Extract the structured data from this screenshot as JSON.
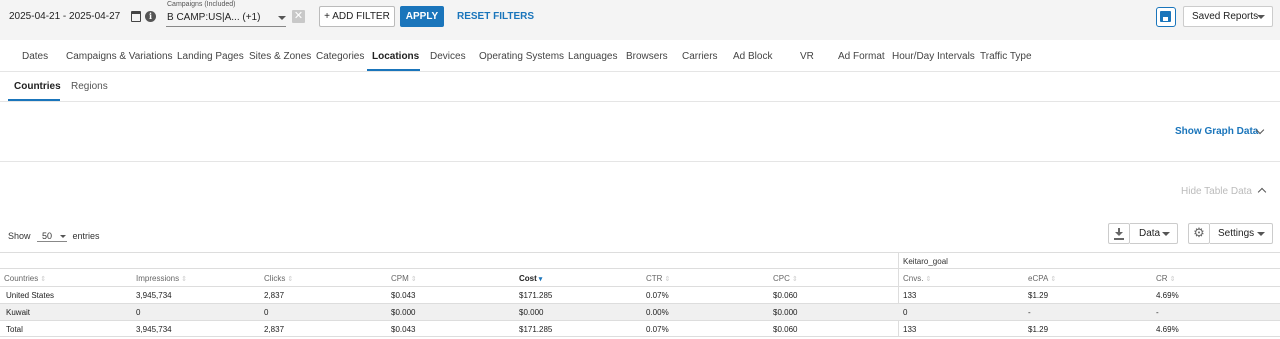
{
  "topbar": {
    "date_range": "2025-04-21 - 2025-04-27",
    "campaign_label": "Campaigns (Included)",
    "campaign_value": "B CAMP:US|A... (+1)",
    "add_filter": "+ ADD FILTER",
    "apply": "APPLY",
    "reset": "RESET FILTERS",
    "saved_reports": "Saved Reports",
    "clear_symbol": "✕",
    "info_symbol": "i"
  },
  "tabs": [
    "Dates",
    "Campaigns & Variations",
    "Landing Pages",
    "Sites & Zones",
    "Categories",
    "Locations",
    "Devices",
    "Operating Systems",
    "Languages",
    "Browsers",
    "Carriers",
    "Ad Block",
    "VR",
    "Ad Format",
    "Hour/Day Intervals",
    "Traffic Type"
  ],
  "active_tab": "Locations",
  "subtabs": [
    "Countries",
    "Regions"
  ],
  "active_subtab": "Countries",
  "graph": {
    "toggle": "Show Graph Data"
  },
  "table_panel": {
    "hide_toggle": "Hide Table Data",
    "show_label": "Show",
    "entries_value": "50",
    "entries_label": "entries",
    "data_button": "Data",
    "settings_button": "Settings",
    "gear_symbol": "⚙"
  },
  "table": {
    "group_header": "Keitaro_goal",
    "columns": [
      "Countries",
      "Impressions",
      "Clicks",
      "CPM",
      "Cost",
      "CTR",
      "CPC",
      "Cnvs.",
      "eCPA",
      "CR"
    ],
    "sorted_column": "Cost",
    "rows": [
      [
        "United States",
        "3,945,734",
        "2,837",
        "$0.043",
        "$171.285",
        "0.07%",
        "$0.060",
        "133",
        "$1.29",
        "4.69%"
      ],
      [
        "Kuwait",
        "0",
        "0",
        "$0.000",
        "$0.000",
        "0.00%",
        "$0.000",
        "0",
        "-",
        "-"
      ]
    ],
    "total": [
      "Total",
      "3,945,734",
      "2,837",
      "$0.043",
      "$171.285",
      "0.07%",
      "$0.060",
      "133",
      "$1.29",
      "4.69%"
    ]
  },
  "colors": {
    "accent": "#1a75bb",
    "topbar_bg": "#f4f4f4",
    "row_alt": "#f0f0f0"
  }
}
